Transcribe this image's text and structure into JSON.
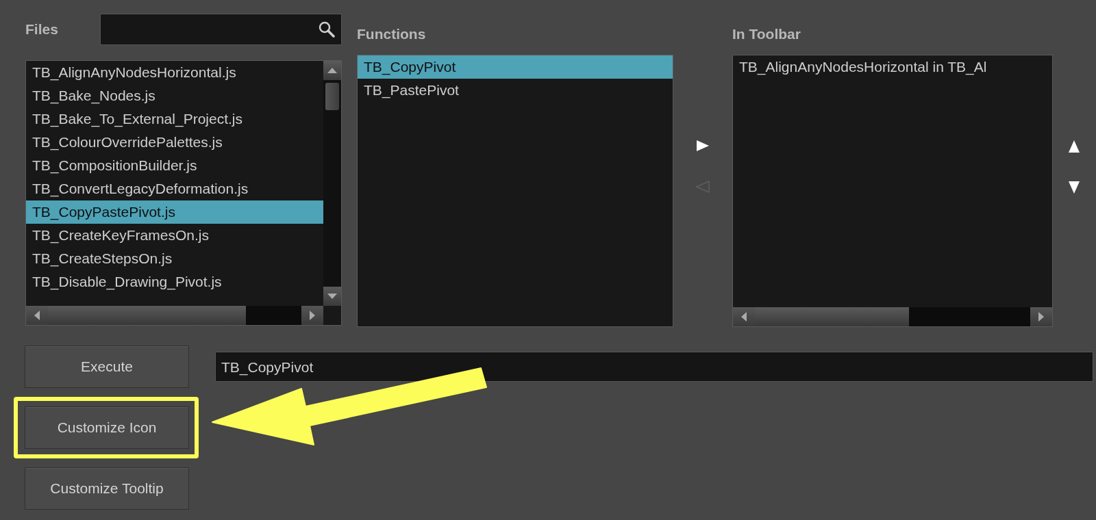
{
  "files": {
    "label": "Files",
    "items": [
      {
        "name": "TB_AlignAnyNodesHorizontal.js",
        "selected": false
      },
      {
        "name": "TB_Bake_Nodes.js",
        "selected": false
      },
      {
        "name": "TB_Bake_To_External_Project.js",
        "selected": false
      },
      {
        "name": "TB_ColourOverridePalettes.js",
        "selected": false
      },
      {
        "name": "TB_CompositionBuilder.js",
        "selected": false
      },
      {
        "name": "TB_ConvertLegacyDeformation.js",
        "selected": false
      },
      {
        "name": "TB_CopyPastePivot.js",
        "selected": true
      },
      {
        "name": "TB_CreateKeyFramesOn.js",
        "selected": false
      },
      {
        "name": "TB_CreateStepsOn.js",
        "selected": false
      },
      {
        "name": "TB_Disable_Drawing_Pivot.js",
        "selected": false
      }
    ]
  },
  "functions": {
    "label": "Functions",
    "items": [
      {
        "name": "TB_CopyPivot",
        "selected": true
      },
      {
        "name": "TB_PastePivot",
        "selected": false
      }
    ]
  },
  "transfer": {
    "add_enabled": true,
    "remove_enabled": false
  },
  "toolbar": {
    "label": "In Toolbar",
    "items": [
      {
        "name": "TB_AlignAnyNodesHorizontal in TB_Al",
        "selected": false
      }
    ]
  },
  "buttons": [
    {
      "label": "Execute",
      "highlighted": false
    },
    {
      "label": "Customize Icon",
      "highlighted": true
    },
    {
      "label": "Customize Tooltip",
      "highlighted": false
    }
  ],
  "function_field": {
    "value": "TB_CopyPivot"
  }
}
